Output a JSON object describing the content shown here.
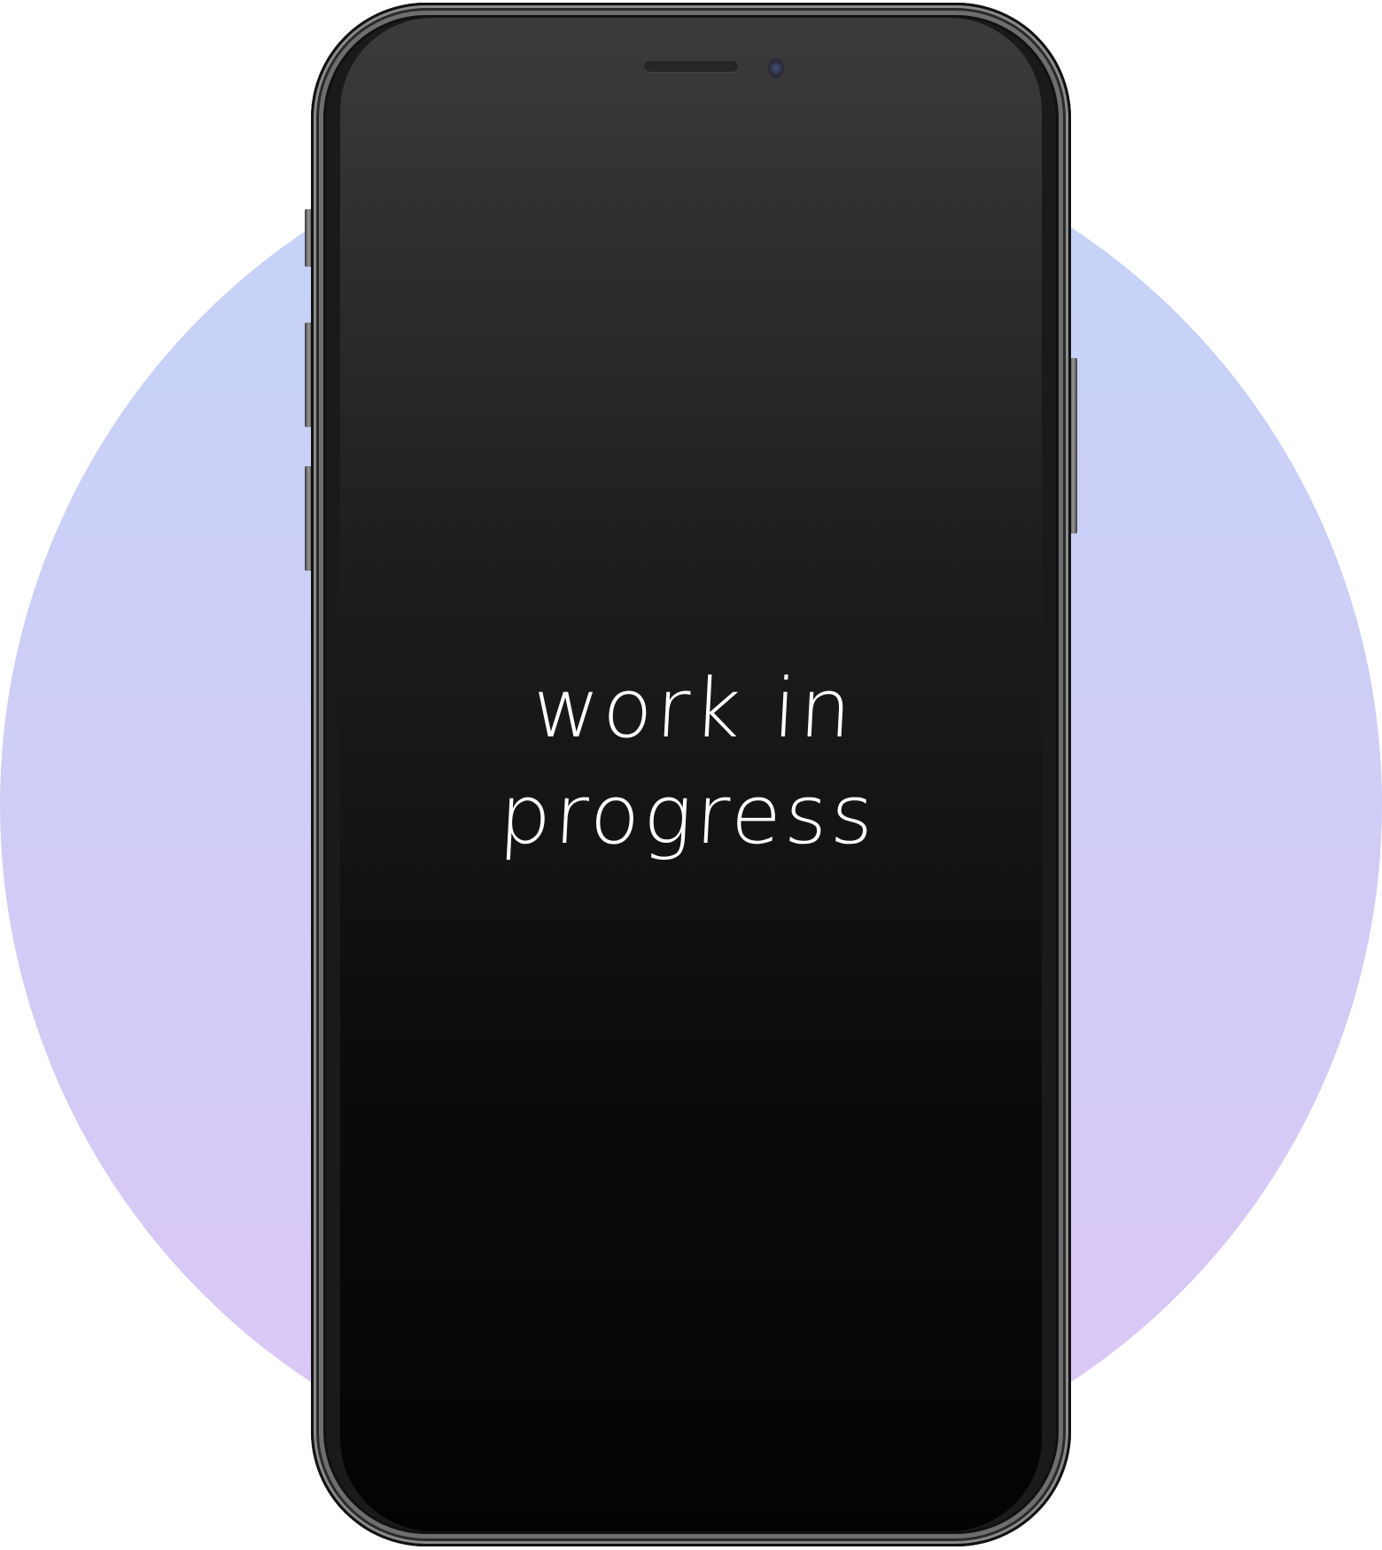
{
  "screen": {
    "message_line1": "work in",
    "message_line2": "progress"
  },
  "colors": {
    "circle_top": "#c4d3f8",
    "circle_bottom": "#dcc6f6",
    "screen": "#0b0b0b",
    "text": "#ffffff"
  }
}
